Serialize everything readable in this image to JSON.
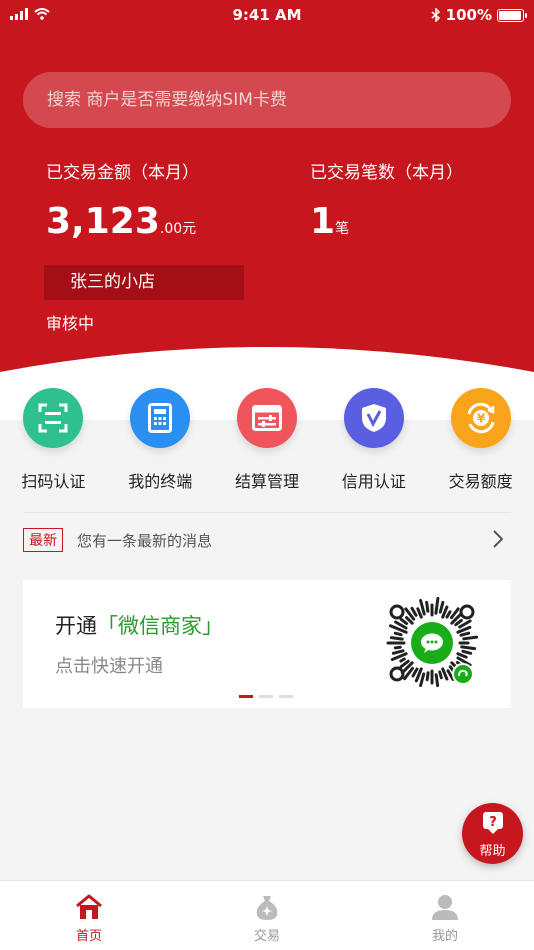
{
  "status": {
    "time": "9:41 AM",
    "battery": "100%",
    "battery_level": 1.0
  },
  "search": {
    "placeholder": "搜索 商户是否需要缴纳SIM卡费"
  },
  "stats": {
    "amount_label": "已交易金额（本月）",
    "amount_value": "3,123",
    "amount_unit": ".00元",
    "count_label": "已交易笔数（本月）",
    "count_value": "1",
    "count_unit": "笔"
  },
  "shop": {
    "name": "张三的小店",
    "status": "审核中"
  },
  "menu": [
    {
      "label": "扫码认证",
      "icon": "scan-icon",
      "color": "#2ec08f"
    },
    {
      "label": "我的终端",
      "icon": "terminal-icon",
      "color": "#2a8ff0"
    },
    {
      "label": "结算管理",
      "icon": "settlement-icon",
      "color": "#f0555c"
    },
    {
      "label": "信用认证",
      "icon": "credit-shield-icon",
      "color": "#5a5ee0"
    },
    {
      "label": "交易额度",
      "icon": "yen-exchange-icon",
      "color": "#f9a41a"
    }
  ],
  "news": {
    "badge": "最新",
    "text": "您有一条最新的消息"
  },
  "banner": {
    "prefix": "开通",
    "highlight": "「微信商家」",
    "subtitle": "点击快速开通",
    "slides": 3,
    "active_slide": 0
  },
  "help": {
    "label": "帮助",
    "icon": "question-icon"
  },
  "tabs": [
    {
      "label": "首页",
      "icon": "home-icon",
      "active": true
    },
    {
      "label": "交易",
      "icon": "money-bag-icon",
      "active": false
    },
    {
      "label": "我的",
      "icon": "user-icon",
      "active": false
    }
  ],
  "colors": {
    "brand_red": "#c7161e",
    "wechat_green": "#2a9b2e"
  }
}
